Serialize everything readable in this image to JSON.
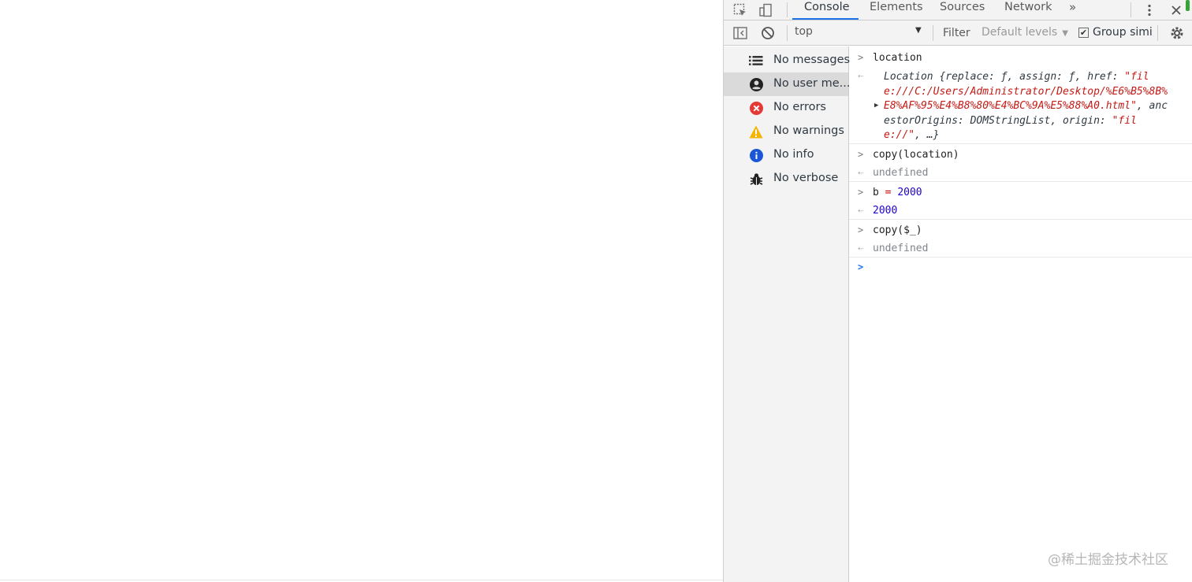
{
  "devtools": {
    "tabs": [
      "Console",
      "Elements",
      "Sources",
      "Network"
    ],
    "more_tabs_icon": "chevrons-right-icon",
    "toolbar": {
      "context": "top",
      "filter_label": "Filter",
      "levels_label": "Default levels",
      "group_similar_label": "Group simi",
      "group_similar_checked": true
    },
    "sidebar": [
      {
        "label": "No messages",
        "icon": "list-icon"
      },
      {
        "label": "No user me...",
        "icon": "user-icon"
      },
      {
        "label": "No errors",
        "icon": "error-icon"
      },
      {
        "label": "No warnings",
        "icon": "warning-icon"
      },
      {
        "label": "No info",
        "icon": "info-icon"
      },
      {
        "label": "No verbose",
        "icon": "bug-icon"
      }
    ],
    "console": {
      "entries": [
        {
          "input": "location",
          "output": {
            "prefix": "Location {replace: ƒ, assign: ƒ, href: ",
            "href": "\"file:///C:/Users/Administrator/Desktop/%E6%B5%8B%E8%AF%95%E4%B8%80%E4%BC%9A%E5%88%A0.html\"",
            "middle": ", ancestorOrigins: DOMStringList, origin: ",
            "origin": "\"file://\"",
            "suffix": ", …}"
          }
        },
        {
          "input": "copy(location)",
          "output": "undefined"
        },
        {
          "input_var": "b",
          "input_op": "=",
          "input_value": "2000",
          "output": "2000"
        },
        {
          "input": "copy($_)",
          "output": "undefined"
        }
      ]
    },
    "colors": {
      "accent": "#1a73e8",
      "error": "#e53935",
      "warning": "#f4b400",
      "info": "#1a56d6"
    }
  },
  "watermark": "@稀土掘金技术社区"
}
